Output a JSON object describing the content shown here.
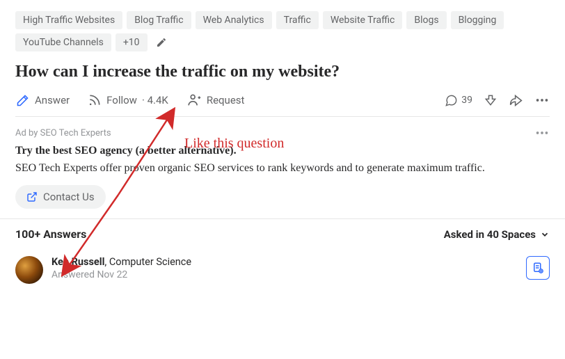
{
  "topics": [
    "High Traffic Websites",
    "Blog Traffic",
    "Web Analytics",
    "Traffic",
    "Website Traffic",
    "Blogs",
    "Blogging",
    "YouTube Channels"
  ],
  "topics_more": "+10",
  "question_title": "How can I increase the traffic on my website?",
  "actions": {
    "answer": "Answer",
    "follow": "Follow",
    "follow_count": "4.4K",
    "request": "Request",
    "comments_count": "39"
  },
  "ad": {
    "label": "Ad by SEO Tech Experts",
    "title": "Try the best SEO agency (a better alternative).",
    "body": "SEO Tech Experts offer proven organic SEO services to rank keywords and to generate maximum traffic.",
    "cta": "Contact Us"
  },
  "answers_header": "100+ Answers",
  "asked_in": "Asked in 40 Spaces",
  "answer": {
    "author_name": "Ken Russell",
    "author_cred": ", Computer Science",
    "answered": "Answered Nov 22"
  },
  "annotation": {
    "text": "Like this question"
  }
}
